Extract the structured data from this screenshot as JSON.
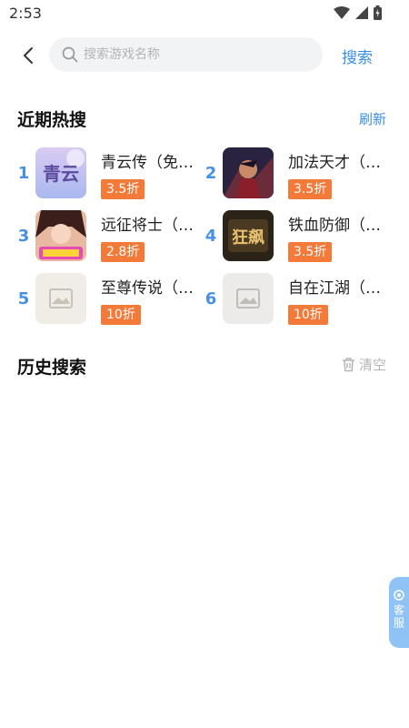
{
  "status": {
    "time": "2:53"
  },
  "search": {
    "placeholder": "搜索游戏名称",
    "button_label": "搜索"
  },
  "hot": {
    "title": "近期热搜",
    "refresh_label": "刷新",
    "items": [
      {
        "rank": "1",
        "name": "青云传（免…",
        "discount": "3.5折",
        "icon": "game-qingyun-icon"
      },
      {
        "rank": "2",
        "name": "加法天才（…",
        "discount": "3.5折",
        "icon": "game-jiafa-icon"
      },
      {
        "rank": "3",
        "name": "远征将士（…",
        "discount": "2.8折",
        "icon": "game-yuanzheng-icon"
      },
      {
        "rank": "4",
        "name": "铁血防御（…",
        "discount": "3.5折",
        "icon": "game-tiexue-icon"
      },
      {
        "rank": "5",
        "name": "至尊传说（…",
        "discount": "10折",
        "icon": "placeholder-image-icon"
      },
      {
        "rank": "6",
        "name": "自在江湖（…",
        "discount": "10折",
        "icon": "placeholder-image-icon"
      }
    ]
  },
  "history": {
    "title": "历史搜索",
    "clear_label": "清空"
  },
  "service": {
    "label": "客服"
  },
  "colors": {
    "accent": "#3a8ee6",
    "rank": "#4a90e2",
    "badge": "#f47a3a"
  }
}
